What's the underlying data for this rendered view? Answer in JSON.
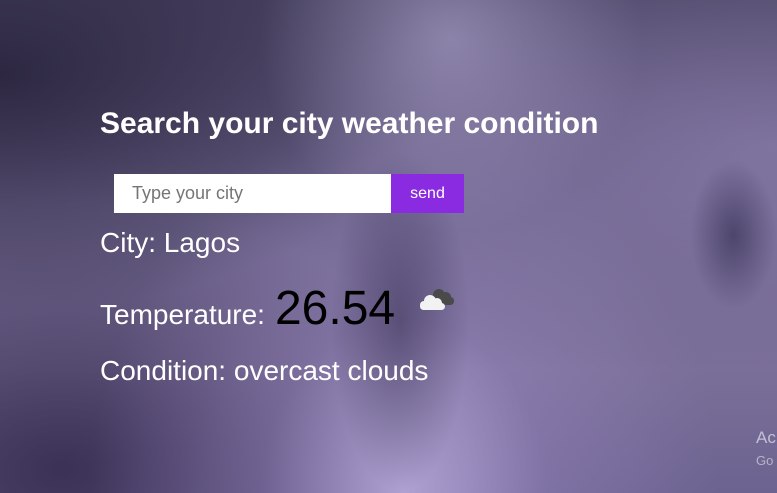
{
  "page": {
    "title": "Search your city weather condition"
  },
  "search": {
    "placeholder": "Type your city",
    "value": "",
    "button_label": "send"
  },
  "weather": {
    "city_label": "City:",
    "city": "Lagos",
    "temperature_label": "Temperature:",
    "temperature": "26.54",
    "condition_label": "Condition:",
    "condition": "overcast clouds",
    "icon": "overcast-clouds-icon"
  },
  "overlay": {
    "activate_line1": "Ac",
    "activate_line2": "Go"
  },
  "colors": {
    "accent": "#8a2be2",
    "text": "#ffffff",
    "temperature_text": "#000000"
  }
}
